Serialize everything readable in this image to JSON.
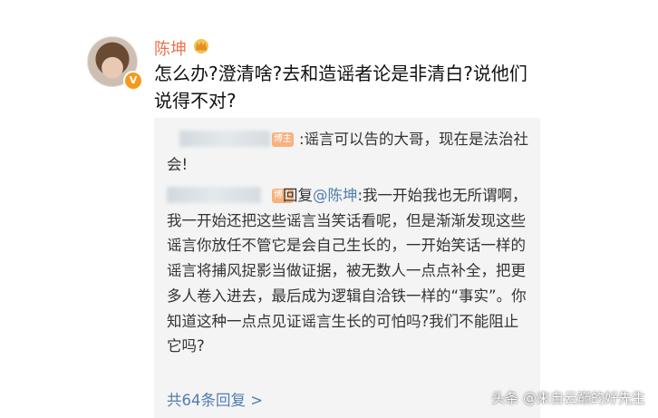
{
  "post": {
    "author": "陈坤",
    "verified_badge": "V",
    "text": "怎么办?澄清啥?去和造谣者论是非清白?说他们说得不对?"
  },
  "replies": [
    {
      "badge": "博主",
      "text": ":谣言可以告的大哥，现在是法治社会!"
    },
    {
      "badge": "博主",
      "reply_prefix": "回复",
      "mention": "@陈坤",
      "text": ":我一开始我也无所谓啊，我一开始还把这些谣言当笑话看呢，但是渐渐发现这些谣言你放任不管它是会自己生长的，一开始笑话一样的谣言将捕风捉影当做证据，被无数人一点点补全，把更多人卷入进去，最后成为逻辑自洽铁一样的“事实”。你知道这种一点点见证谣言生长的可怕吗?我们不能阻止它吗?"
    }
  ],
  "total_replies": "共64条回复 >",
  "watermark": "头条 @来自云巅的好先生",
  "colors": {
    "username": "#eb7350",
    "link": "#507daf",
    "badge": "#f7b27f",
    "verified": "#f59a1d"
  },
  "icons": {
    "crown": "crown-icon",
    "verified": "verified-v-icon"
  }
}
